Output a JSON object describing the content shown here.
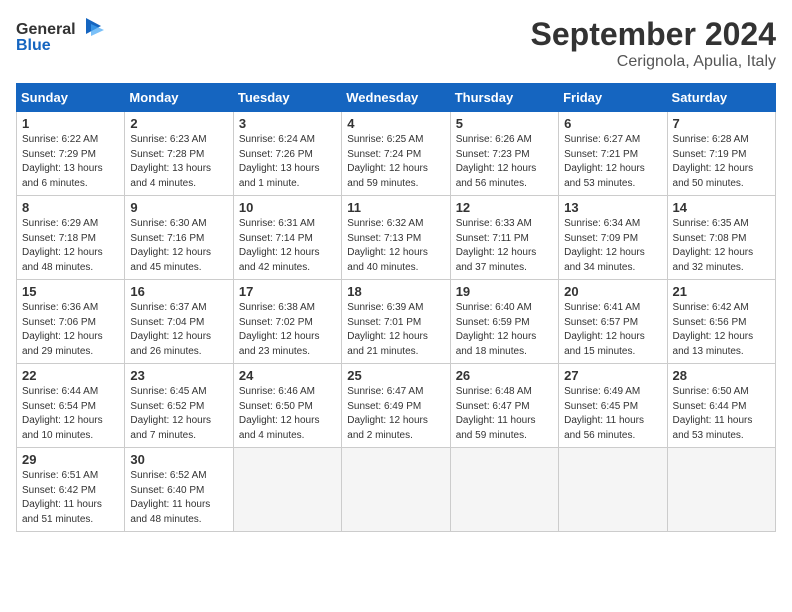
{
  "header": {
    "logo_line1": "General",
    "logo_line2": "Blue",
    "month": "September 2024",
    "location": "Cerignola, Apulia, Italy"
  },
  "weekdays": [
    "Sunday",
    "Monday",
    "Tuesday",
    "Wednesday",
    "Thursday",
    "Friday",
    "Saturday"
  ],
  "weeks": [
    [
      {
        "day": "1",
        "info": "Sunrise: 6:22 AM\nSunset: 7:29 PM\nDaylight: 13 hours\nand 6 minutes."
      },
      {
        "day": "2",
        "info": "Sunrise: 6:23 AM\nSunset: 7:28 PM\nDaylight: 13 hours\nand 4 minutes."
      },
      {
        "day": "3",
        "info": "Sunrise: 6:24 AM\nSunset: 7:26 PM\nDaylight: 13 hours\nand 1 minute."
      },
      {
        "day": "4",
        "info": "Sunrise: 6:25 AM\nSunset: 7:24 PM\nDaylight: 12 hours\nand 59 minutes."
      },
      {
        "day": "5",
        "info": "Sunrise: 6:26 AM\nSunset: 7:23 PM\nDaylight: 12 hours\nand 56 minutes."
      },
      {
        "day": "6",
        "info": "Sunrise: 6:27 AM\nSunset: 7:21 PM\nDaylight: 12 hours\nand 53 minutes."
      },
      {
        "day": "7",
        "info": "Sunrise: 6:28 AM\nSunset: 7:19 PM\nDaylight: 12 hours\nand 50 minutes."
      }
    ],
    [
      {
        "day": "8",
        "info": "Sunrise: 6:29 AM\nSunset: 7:18 PM\nDaylight: 12 hours\nand 48 minutes."
      },
      {
        "day": "9",
        "info": "Sunrise: 6:30 AM\nSunset: 7:16 PM\nDaylight: 12 hours\nand 45 minutes."
      },
      {
        "day": "10",
        "info": "Sunrise: 6:31 AM\nSunset: 7:14 PM\nDaylight: 12 hours\nand 42 minutes."
      },
      {
        "day": "11",
        "info": "Sunrise: 6:32 AM\nSunset: 7:13 PM\nDaylight: 12 hours\nand 40 minutes."
      },
      {
        "day": "12",
        "info": "Sunrise: 6:33 AM\nSunset: 7:11 PM\nDaylight: 12 hours\nand 37 minutes."
      },
      {
        "day": "13",
        "info": "Sunrise: 6:34 AM\nSunset: 7:09 PM\nDaylight: 12 hours\nand 34 minutes."
      },
      {
        "day": "14",
        "info": "Sunrise: 6:35 AM\nSunset: 7:08 PM\nDaylight: 12 hours\nand 32 minutes."
      }
    ],
    [
      {
        "day": "15",
        "info": "Sunrise: 6:36 AM\nSunset: 7:06 PM\nDaylight: 12 hours\nand 29 minutes."
      },
      {
        "day": "16",
        "info": "Sunrise: 6:37 AM\nSunset: 7:04 PM\nDaylight: 12 hours\nand 26 minutes."
      },
      {
        "day": "17",
        "info": "Sunrise: 6:38 AM\nSunset: 7:02 PM\nDaylight: 12 hours\nand 23 minutes."
      },
      {
        "day": "18",
        "info": "Sunrise: 6:39 AM\nSunset: 7:01 PM\nDaylight: 12 hours\nand 21 minutes."
      },
      {
        "day": "19",
        "info": "Sunrise: 6:40 AM\nSunset: 6:59 PM\nDaylight: 12 hours\nand 18 minutes."
      },
      {
        "day": "20",
        "info": "Sunrise: 6:41 AM\nSunset: 6:57 PM\nDaylight: 12 hours\nand 15 minutes."
      },
      {
        "day": "21",
        "info": "Sunrise: 6:42 AM\nSunset: 6:56 PM\nDaylight: 12 hours\nand 13 minutes."
      }
    ],
    [
      {
        "day": "22",
        "info": "Sunrise: 6:44 AM\nSunset: 6:54 PM\nDaylight: 12 hours\nand 10 minutes."
      },
      {
        "day": "23",
        "info": "Sunrise: 6:45 AM\nSunset: 6:52 PM\nDaylight: 12 hours\nand 7 minutes."
      },
      {
        "day": "24",
        "info": "Sunrise: 6:46 AM\nSunset: 6:50 PM\nDaylight: 12 hours\nand 4 minutes."
      },
      {
        "day": "25",
        "info": "Sunrise: 6:47 AM\nSunset: 6:49 PM\nDaylight: 12 hours\nand 2 minutes."
      },
      {
        "day": "26",
        "info": "Sunrise: 6:48 AM\nSunset: 6:47 PM\nDaylight: 11 hours\nand 59 minutes."
      },
      {
        "day": "27",
        "info": "Sunrise: 6:49 AM\nSunset: 6:45 PM\nDaylight: 11 hours\nand 56 minutes."
      },
      {
        "day": "28",
        "info": "Sunrise: 6:50 AM\nSunset: 6:44 PM\nDaylight: 11 hours\nand 53 minutes."
      }
    ],
    [
      {
        "day": "29",
        "info": "Sunrise: 6:51 AM\nSunset: 6:42 PM\nDaylight: 11 hours\nand 51 minutes."
      },
      {
        "day": "30",
        "info": "Sunrise: 6:52 AM\nSunset: 6:40 PM\nDaylight: 11 hours\nand 48 minutes."
      },
      {
        "day": "",
        "info": ""
      },
      {
        "day": "",
        "info": ""
      },
      {
        "day": "",
        "info": ""
      },
      {
        "day": "",
        "info": ""
      },
      {
        "day": "",
        "info": ""
      }
    ]
  ]
}
